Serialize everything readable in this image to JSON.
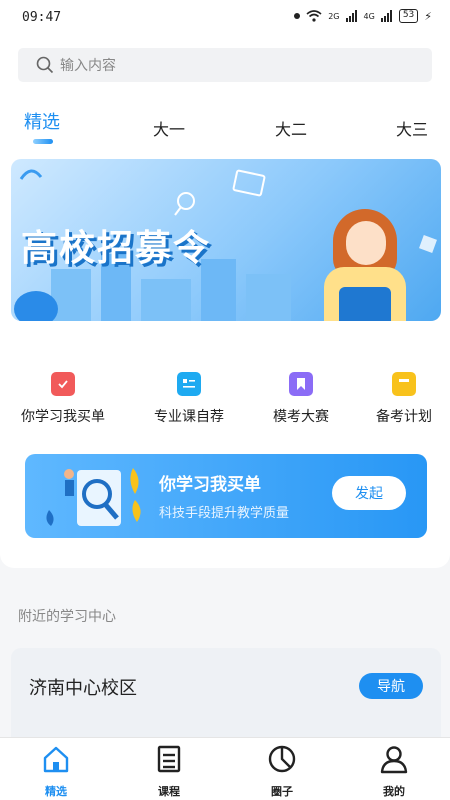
{
  "status": {
    "time": "09:47",
    "battery": "53",
    "net1": "2G",
    "net2": "4G"
  },
  "search": {
    "placeholder": "输入内容"
  },
  "tabs": [
    {
      "label": "精选",
      "active": true
    },
    {
      "label": "大一"
    },
    {
      "label": "大二"
    },
    {
      "label": "大三"
    }
  ],
  "banner": {
    "title": "高校招募令"
  },
  "quick_links": [
    {
      "label": "你学习我买单",
      "icon": "check-doc-icon",
      "color": "#f15a5a"
    },
    {
      "label": "专业课自荐",
      "icon": "id-card-icon",
      "color": "#1eaaf1"
    },
    {
      "label": "模考大赛",
      "icon": "bookmark-icon",
      "color": "#8b6cf6"
    },
    {
      "label": "备考计划",
      "icon": "notebook-icon",
      "color": "#f8c21c"
    }
  ],
  "promo": {
    "title": "你学习我买单",
    "subtitle": "科技手段提升教学质量",
    "button": "发起"
  },
  "nearby": {
    "section_title": "附近的学习中心",
    "center_name": "济南中心校区",
    "nav_button": "导航"
  },
  "bottom_nav": [
    {
      "label": "精选",
      "icon": "home-icon",
      "active": true
    },
    {
      "label": "课程",
      "icon": "course-icon"
    },
    {
      "label": "圈子",
      "icon": "pie-chart-icon"
    },
    {
      "label": "我的",
      "icon": "user-icon"
    }
  ],
  "colors": {
    "accent": "#1e8ff1"
  }
}
